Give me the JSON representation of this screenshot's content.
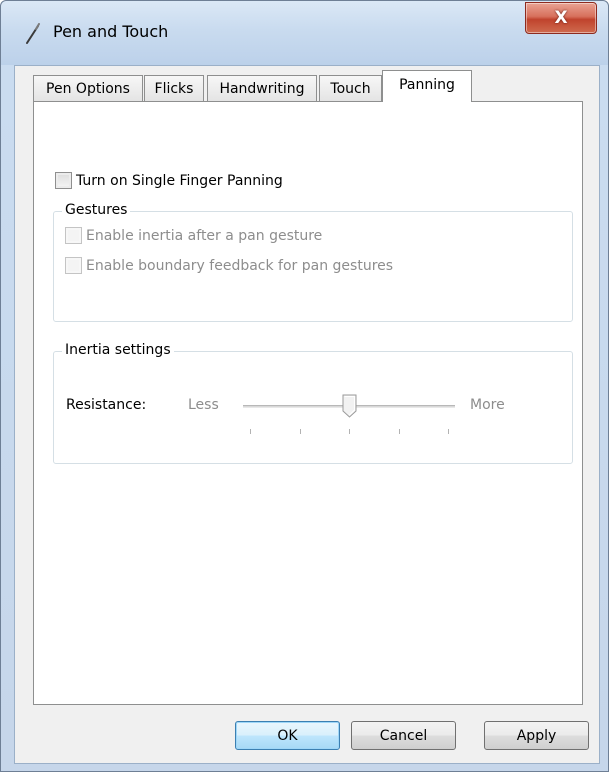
{
  "window": {
    "title": "Pen and Touch",
    "close_symbol": "X"
  },
  "tabs": [
    {
      "label": "Pen Options",
      "active": false
    },
    {
      "label": "Flicks",
      "active": false
    },
    {
      "label": "Handwriting",
      "active": false
    },
    {
      "label": "Touch",
      "active": false
    },
    {
      "label": "Panning",
      "active": true
    }
  ],
  "panning": {
    "single_finger_panning": {
      "label": "Turn on Single Finger Panning",
      "checked": false
    },
    "gestures": {
      "title": "Gestures",
      "inertia": {
        "label": "Enable inertia after a pan gesture",
        "checked": false,
        "enabled": false
      },
      "boundary": {
        "label": "Enable boundary feedback for pan gestures",
        "checked": false,
        "enabled": false
      }
    },
    "inertia_settings": {
      "title": "Inertia settings",
      "resistance_label": "Resistance:",
      "min_label": "Less",
      "max_label": "More",
      "resistance_value": 0.5,
      "enabled": false
    }
  },
  "buttons": {
    "ok": "OK",
    "cancel": "Cancel",
    "apply": "Apply"
  },
  "colors": {
    "titlebar": "#c9dbef",
    "close_button": "#c0432d",
    "default_button": "#bee6fd",
    "disabled_text": "#8d8d8d"
  }
}
